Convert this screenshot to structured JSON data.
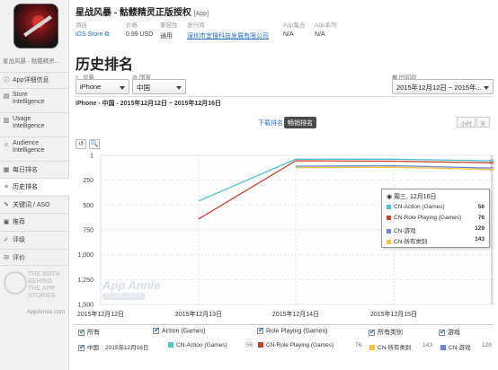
{
  "app": {
    "title": "星战风暴 - 骷髅精灵正版授权",
    "tag": "[App]",
    "short_name": "星战风暴 - 骷髅精灵...",
    "meta": [
      {
        "label": "商店",
        "value": "iOS Store"
      },
      {
        "label": "价格",
        "value": "0.99 USD"
      },
      {
        "label": "兼容性",
        "value": "通用"
      },
      {
        "label": "发行商",
        "value": "深圳市宜搜科技发展有限公司"
      },
      {
        "label": "App集合",
        "value": "N/A"
      },
      {
        "label": "App系列",
        "value": "N/A"
      }
    ]
  },
  "sidebar": {
    "items": [
      {
        "label": "App详细信息",
        "icon": "info-icon"
      },
      {
        "label": "Store Intelligence",
        "icon": "chart-icon"
      },
      {
        "label": "Usage Intelligence",
        "icon": "usage-icon"
      },
      {
        "label": "Audience Intelligence",
        "icon": "audience-icon"
      },
      {
        "label": "每日排名",
        "icon": "calendar-icon"
      },
      {
        "label": "历史排名",
        "icon": "history-icon"
      },
      {
        "label": "关键词 / ASO",
        "icon": "key-icon"
      },
      {
        "label": "推荐",
        "icon": "thumb-icon"
      },
      {
        "label": "评级",
        "icon": "rating-icon"
      },
      {
        "label": "评价",
        "icon": "comment-icon"
      }
    ],
    "watermark_text": "THE MATH BEHIND THE APP STORIES",
    "site": "AppAnnie.com"
  },
  "page_title": "历史排名",
  "filters": {
    "device_label": "设备",
    "device_value": "iPhone",
    "country_label": "国家",
    "country_value": "中国",
    "range_label": "时间段",
    "range_value": "2015年12月12日 ~ 2015年..."
  },
  "subtitle": "iPhone - 中国 - 2015年12月12日 ~ 2015年12月16日",
  "toggles": {
    "downloads": "下载排名",
    "grossing": "畅销排名",
    "hour": "小时",
    "day": "天"
  },
  "tools": {
    "reset": "↺",
    "zoom": "🔍"
  },
  "tooltip": {
    "header": "周三, 12月16日",
    "rows": [
      {
        "label": "CN-Action (Games)",
        "value": "56",
        "color": "#4fc1cf"
      },
      {
        "label": "CN-Role Playing (Games)",
        "value": "76",
        "color": "#c9432b"
      },
      {
        "label": "CN-游戏",
        "value": "129",
        "color": "#6b84d6"
      },
      {
        "label": "CN-所有类别",
        "value": "143",
        "color": "#f0c53d"
      }
    ]
  },
  "watermark": {
    "brand": "App Annie",
    "badge": "STORE STATS"
  },
  "legend": {
    "headers": [
      "所有",
      "Action (Games)",
      "Role Playing (Games)",
      "所有类别",
      "游戏"
    ],
    "country": "中国",
    "date": "2015年12月16日",
    "entries": [
      {
        "label": "CN-Action (Games)",
        "value": "56",
        "color": "#4fc1cf"
      },
      {
        "label": "CN-Role Playing (Games)",
        "value": "76",
        "color": "#c9432b"
      },
      {
        "label": "CN-所有类别",
        "value": "143",
        "color": "#f0c53d"
      },
      {
        "label": "CN-游戏",
        "value": "129",
        "color": "#6b84d6"
      }
    ]
  },
  "chart_data": {
    "type": "line",
    "x": [
      "2015-12-12",
      "2015-12-13",
      "2015-12-14",
      "2015-12-15",
      "2015-12-16"
    ],
    "x_tick_labels": [
      "2015年12月12日",
      "2015年12月13日",
      "2015年12月14日",
      "2015年12月15日"
    ],
    "y_ticks": [
      1,
      250,
      500,
      750,
      1000,
      1250,
      1500
    ],
    "ylim": [
      1,
      1500
    ],
    "y_inverted": true,
    "grid": true,
    "series": [
      {
        "name": "CN-Action (Games)",
        "color": "#4fc1cf",
        "points": [
          [
            "2015-12-13",
            460
          ],
          [
            "2015-12-14",
            40
          ],
          [
            "2015-12-15",
            40
          ],
          [
            "2015-12-16",
            56
          ]
        ]
      },
      {
        "name": "CN-Role Playing (Games)",
        "color": "#c9432b",
        "points": [
          [
            "2015-12-13",
            640
          ],
          [
            "2015-12-14",
            55
          ],
          [
            "2015-12-15",
            60
          ],
          [
            "2015-12-16",
            76
          ]
        ]
      },
      {
        "name": "CN-游戏",
        "color": "#6b84d6",
        "points": [
          [
            "2015-12-14",
            110
          ],
          [
            "2015-12-15",
            105
          ],
          [
            "2015-12-16",
            129
          ]
        ]
      },
      {
        "name": "CN-所有类别",
        "color": "#f0c53d",
        "points": [
          [
            "2015-12-14",
            125
          ],
          [
            "2015-12-15",
            120
          ],
          [
            "2015-12-16",
            143
          ]
        ]
      }
    ]
  }
}
